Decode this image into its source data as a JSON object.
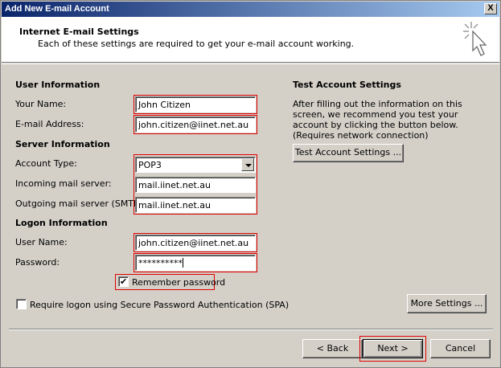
{
  "window": {
    "title": "Add New E-mail Account",
    "close_glyph": "X"
  },
  "header": {
    "title": "Internet E-mail Settings",
    "subtitle": "Each of these settings are required to get your e-mail account working."
  },
  "user_info": {
    "heading": "User Information",
    "name_label": "Your Name:",
    "name_value": "John Citizen",
    "email_label": "E-mail Address:",
    "email_value": "john.citizen@iinet.net.au"
  },
  "server_info": {
    "heading": "Server Information",
    "account_type_label": "Account Type:",
    "account_type_value": "POP3",
    "incoming_label": "Incoming mail server:",
    "incoming_value": "mail.iinet.net.au",
    "outgoing_label": "Outgoing mail server (SMTP):",
    "outgoing_value": "mail.iinet.net.au"
  },
  "logon_info": {
    "heading": "Logon Information",
    "username_label": "User Name:",
    "username_value": "john.citizen@iinet.net.au",
    "password_label": "Password:",
    "password_value": "**********",
    "remember_label": "Remember password",
    "remember_checked": true,
    "spa_label": "Require logon using Secure Password Authentication (SPA)",
    "spa_checked": false
  },
  "test_settings": {
    "heading": "Test Account Settings",
    "description": "After filling out the information on this screen, we recommend you test your account by clicking the button below. (Requires network connection)",
    "button_label": "Test Account Settings ..."
  },
  "buttons": {
    "more_settings": "More Settings ...",
    "back": "< Back",
    "next": "Next >",
    "cancel": "Cancel"
  },
  "colors": {
    "highlight_border": "#e00000",
    "title_start": "#0a246a",
    "title_end": "#a6caf0"
  },
  "icons": {
    "wizard": "sparkle-cursor-icon",
    "check": "checkmark-icon",
    "dropdown": "chevron-down-icon"
  }
}
